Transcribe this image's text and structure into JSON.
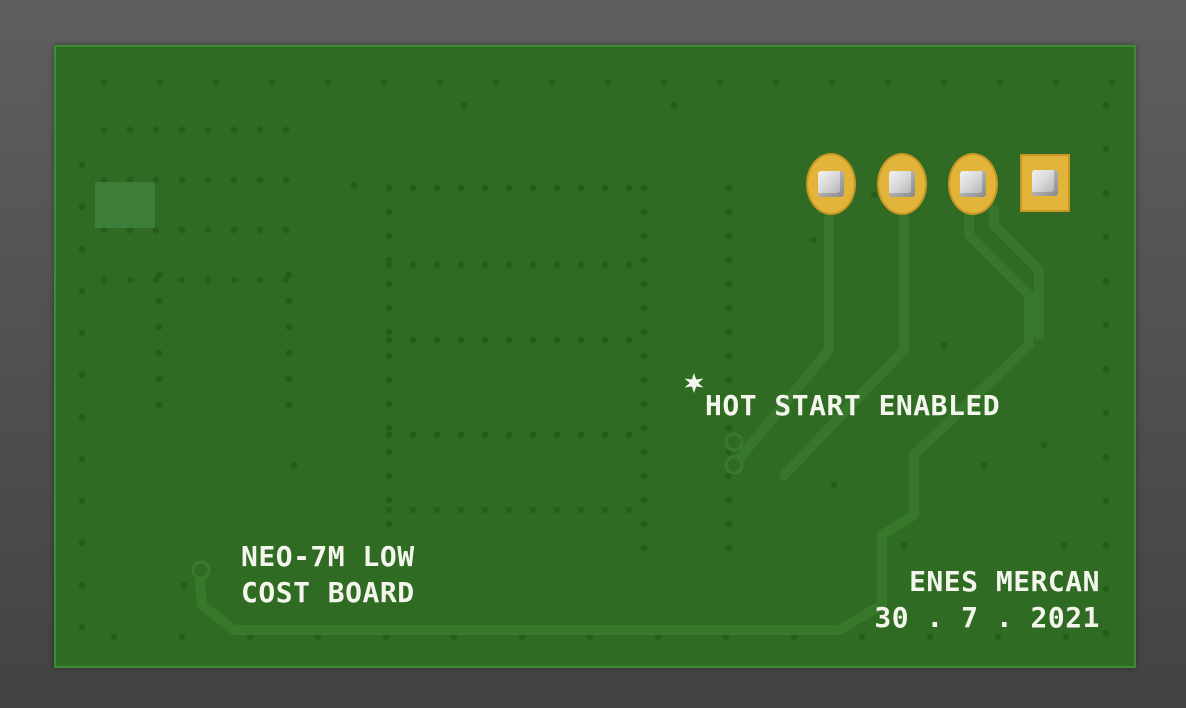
{
  "board": {
    "silkscreen_hot_start": "HOT START ENABLED",
    "silkscreen_board_line1": "NEO-7M LOW",
    "silkscreen_board_line2": "COST BOARD",
    "silkscreen_author": "ENES MERCAN",
    "silkscreen_date": "30 . 7 . 2021"
  },
  "colors": {
    "background": "#555555",
    "board_green": "#2f6b22",
    "board_edge": "#3f8a34",
    "pad_gold": "#e3b43a",
    "silkscreen": "#f4f6ee",
    "pin_silver": "#d8d8d8"
  },
  "icons": {
    "star_marker": "star-icon",
    "connector_pins": "pin-header-icon"
  },
  "connector": {
    "pin_count": 4,
    "pin1_shape": "square"
  }
}
